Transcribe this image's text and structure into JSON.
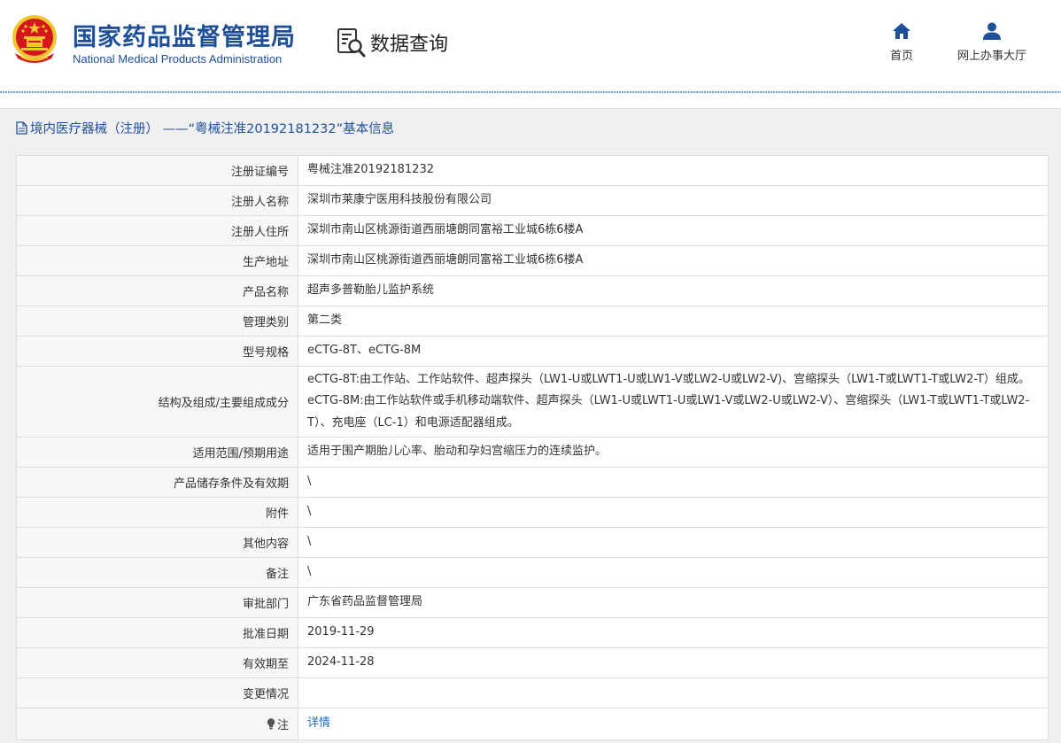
{
  "header": {
    "org_name_cn": "国家药品监督管理局",
    "org_name_en": "National Medical Products Administration",
    "emblem_icon": "national-emblem-icon",
    "query_icon": "document-search-icon",
    "query_label": "数据查询",
    "nav": [
      {
        "label": "首页",
        "icon": "home-icon"
      },
      {
        "label": "网上办事大厅",
        "icon": "user-icon"
      }
    ]
  },
  "panel": {
    "title": "境内医疗器械（注册） ——“粤械注准20192181232”基本信息",
    "title_icon": "document-icon"
  },
  "rows": [
    {
      "label": "注册证编号",
      "value": "粤械注准20192181232"
    },
    {
      "label": "注册人名称",
      "value": "深圳市莱康宁医用科技股份有限公司"
    },
    {
      "label": "注册人住所",
      "value": "深圳市南山区桃源街道西丽塘朗同富裕工业城6栋6楼A"
    },
    {
      "label": "生产地址",
      "value": "深圳市南山区桃源街道西丽塘朗同富裕工业城6栋6楼A"
    },
    {
      "label": "产品名称",
      "value": "超声多普勒胎儿监护系统"
    },
    {
      "label": "管理类别",
      "value": "第二类"
    },
    {
      "label": "型号规格",
      "value": "eCTG-8T、eCTG-8M"
    },
    {
      "label": "结构及组成/主要组成成分",
      "value": "eCTG-8T:由工作站、工作站软件、超声探头（LW1-U或LWT1-U或LW1-V或LW2-U或LW2-V)、宫缩探头（LW1-T或LWT1-T或LW2-T）组成。eCTG-8M:由工作站软件或手机移动端软件、超声探头（LW1-U或LWT1-U或LW1-V或LW2-U或LW2-V）、宫缩探头（LW1-T或LWT1-T或LW2-T）、充电座（LC-1）和电源适配器组成。"
    },
    {
      "label": "适用范围/预期用途",
      "value": "适用于围产期胎儿心率、胎动和孕妇宫缩压力的连续监护。"
    },
    {
      "label": "产品储存条件及有效期",
      "value": "\\"
    },
    {
      "label": "附件",
      "value": "\\"
    },
    {
      "label": "其他内容",
      "value": "\\"
    },
    {
      "label": "备注",
      "value": "\\"
    },
    {
      "label": "审批部门",
      "value": "广东省药品监督管理局"
    },
    {
      "label": "批准日期",
      "value": "2019-11-29"
    },
    {
      "label": "有效期至",
      "value": "2024-11-28"
    },
    {
      "label": "变更情况",
      "value": ""
    }
  ],
  "note_row": {
    "label": "注",
    "icon": "bulb-icon",
    "link": "详情"
  },
  "colors": {
    "brand_blue": "#1e4f98",
    "link_blue": "#1e6fc0",
    "emblem_red": "#d4171b",
    "emblem_gold": "#f2c531"
  }
}
